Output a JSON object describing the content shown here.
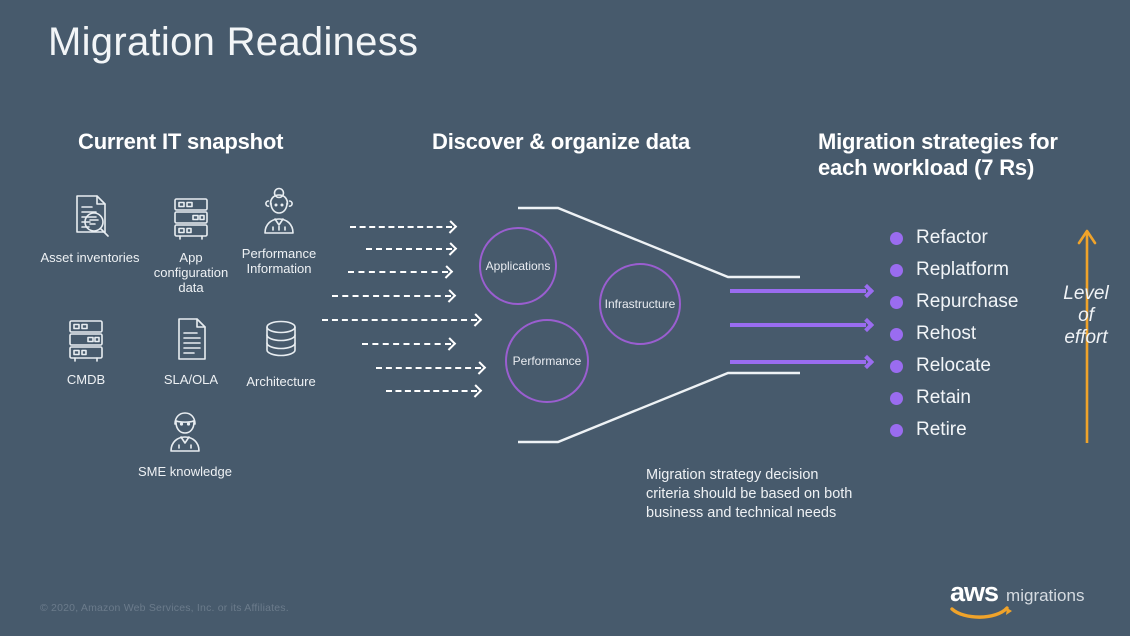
{
  "slide": {
    "title": "Migration Readiness",
    "background_color": "#475a6c",
    "accent_purple": "#9a6cf0",
    "accent_orange": "#f0a32a"
  },
  "sections": {
    "left_heading": "Current IT snapshot",
    "middle_heading": "Discover & organize data",
    "right_heading_line1": "Migration strategies for",
    "right_heading_line2": "each workload (7 Rs)"
  },
  "inputs": [
    {
      "icon": "document-magnifier-icon",
      "label": "Asset inventories"
    },
    {
      "icon": "server-rack-icon",
      "label_line1": "App",
      "label_line2": "configuration",
      "label_line3": "data"
    },
    {
      "icon": "person-headset-icon",
      "label_line1": "Performance",
      "label_line2": "Information"
    },
    {
      "icon": "server-rack-icon",
      "label": "CMDB"
    },
    {
      "icon": "document-icon",
      "label": "SLA/OLA"
    },
    {
      "icon": "database-cylinder-icon",
      "label": "Architecture"
    },
    {
      "icon": "person-icon",
      "label": "SME knowledge"
    }
  ],
  "bubbles": [
    {
      "label": "Applications"
    },
    {
      "label": "Infrastructure"
    },
    {
      "label": "Performance"
    }
  ],
  "strategies": [
    {
      "label": "Refactor"
    },
    {
      "label": "Replatform"
    },
    {
      "label": "Repurchase"
    },
    {
      "label": "Rehost"
    },
    {
      "label": "Relocate"
    },
    {
      "label": "Retain"
    },
    {
      "label": "Retire"
    }
  ],
  "effort": {
    "line1": "Level",
    "line2": "of",
    "line3": "effort",
    "arrow_direction": "up",
    "color": "#f0a32a"
  },
  "caption": {
    "line1": "Migration strategy decision",
    "line2": "criteria should be based on both",
    "line3": "business and technical needs"
  },
  "footer": {
    "copyright": "© 2020, Amazon Web Services, Inc. or its Affiliates.",
    "logo_text": "aws",
    "logo_sub": "migrations"
  }
}
